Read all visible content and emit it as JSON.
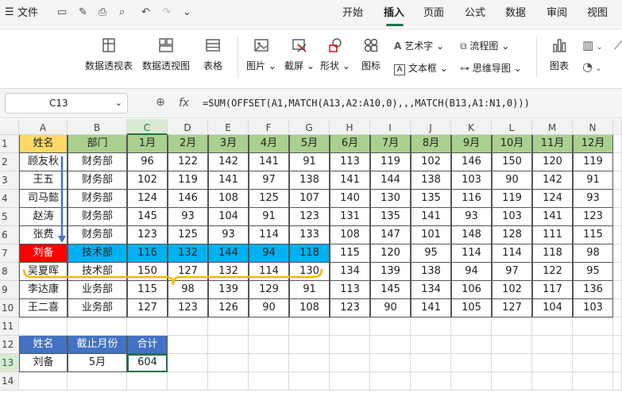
{
  "menu": {
    "file": "文件",
    "tabs": [
      "开始",
      "插入",
      "页面",
      "公式",
      "数据",
      "审阅",
      "视图"
    ],
    "active_tab": "插入"
  },
  "ribbon": {
    "pivot_table": "数据透视表",
    "pivot_chart": "数据透视图",
    "table": "表格",
    "picture": "图片",
    "screenshot": "截屏",
    "shape": "形状",
    "icon": "图标",
    "art_text": "艺术字",
    "text_box": "文本框",
    "flowchart": "流程图",
    "mind_map": "思维导图",
    "chart": "图表"
  },
  "formula_bar": {
    "cell_ref": "C13",
    "fx": "fx",
    "formula": "=SUM(OFFSET(A1,MATCH(A13,A2:A10,0),,,MATCH(B13,A1:N1,0)))"
  },
  "columns": [
    "A",
    "B",
    "C",
    "D",
    "E",
    "F",
    "G",
    "H",
    "I",
    "J",
    "K",
    "L",
    "M",
    "N"
  ],
  "rows": [
    "1",
    "2",
    "3",
    "4",
    "5",
    "6",
    "7",
    "8",
    "9",
    "10",
    "11",
    "12",
    "13",
    "14"
  ],
  "header": [
    "姓名",
    "部门",
    "1月",
    "2月",
    "3月",
    "4月",
    "5月",
    "6月",
    "7月",
    "8月",
    "9月",
    "10月",
    "11月",
    "12月"
  ],
  "data_rows": [
    [
      "顾友秋",
      "财务部",
      "96",
      "122",
      "142",
      "141",
      "91",
      "113",
      "119",
      "102",
      "146",
      "150",
      "120",
      "119"
    ],
    [
      "王五",
      "财务部",
      "102",
      "119",
      "141",
      "97",
      "138",
      "141",
      "144",
      "138",
      "103",
      "90",
      "142",
      "91"
    ],
    [
      "司马懿",
      "财务部",
      "124",
      "146",
      "108",
      "125",
      "107",
      "140",
      "130",
      "135",
      "116",
      "119",
      "124",
      "93"
    ],
    [
      "赵涛",
      "财务部",
      "145",
      "93",
      "104",
      "91",
      "123",
      "131",
      "135",
      "141",
      "93",
      "103",
      "141",
      "123"
    ],
    [
      "张费",
      "财务部",
      "123",
      "125",
      "93",
      "114",
      "133",
      "108",
      "147",
      "101",
      "148",
      "128",
      "111",
      "115"
    ],
    [
      "刘备",
      "技术部",
      "116",
      "132",
      "144",
      "94",
      "118",
      "115",
      "120",
      "95",
      "114",
      "114",
      "118",
      "98"
    ],
    [
      "吴夏晖",
      "技术部",
      "150",
      "127",
      "132",
      "114",
      "130",
      "134",
      "139",
      "138",
      "94",
      "97",
      "122",
      "95"
    ],
    [
      "李达康",
      "业务部",
      "115",
      "98",
      "139",
      "129",
      "91",
      "113",
      "145",
      "134",
      "106",
      "102",
      "117",
      "136"
    ],
    [
      "王二喜",
      "业务部",
      "127",
      "123",
      "126",
      "90",
      "108",
      "123",
      "90",
      "141",
      "105",
      "127",
      "104",
      "103"
    ]
  ],
  "lookup_header": [
    "姓名",
    "截止月份",
    "合计"
  ],
  "lookup_values": [
    "刘备",
    "5月",
    "604"
  ],
  "colors": {
    "header_name": "#ffd966",
    "header_green": "#a9d08e",
    "highlight_blue": "#00b0f0",
    "highlight_red": "#ff0000",
    "lookup_header": "#4472c4",
    "brace_orange": "#f5b800",
    "arrow_blue": "#4472c4",
    "selection_green": "#217346"
  }
}
